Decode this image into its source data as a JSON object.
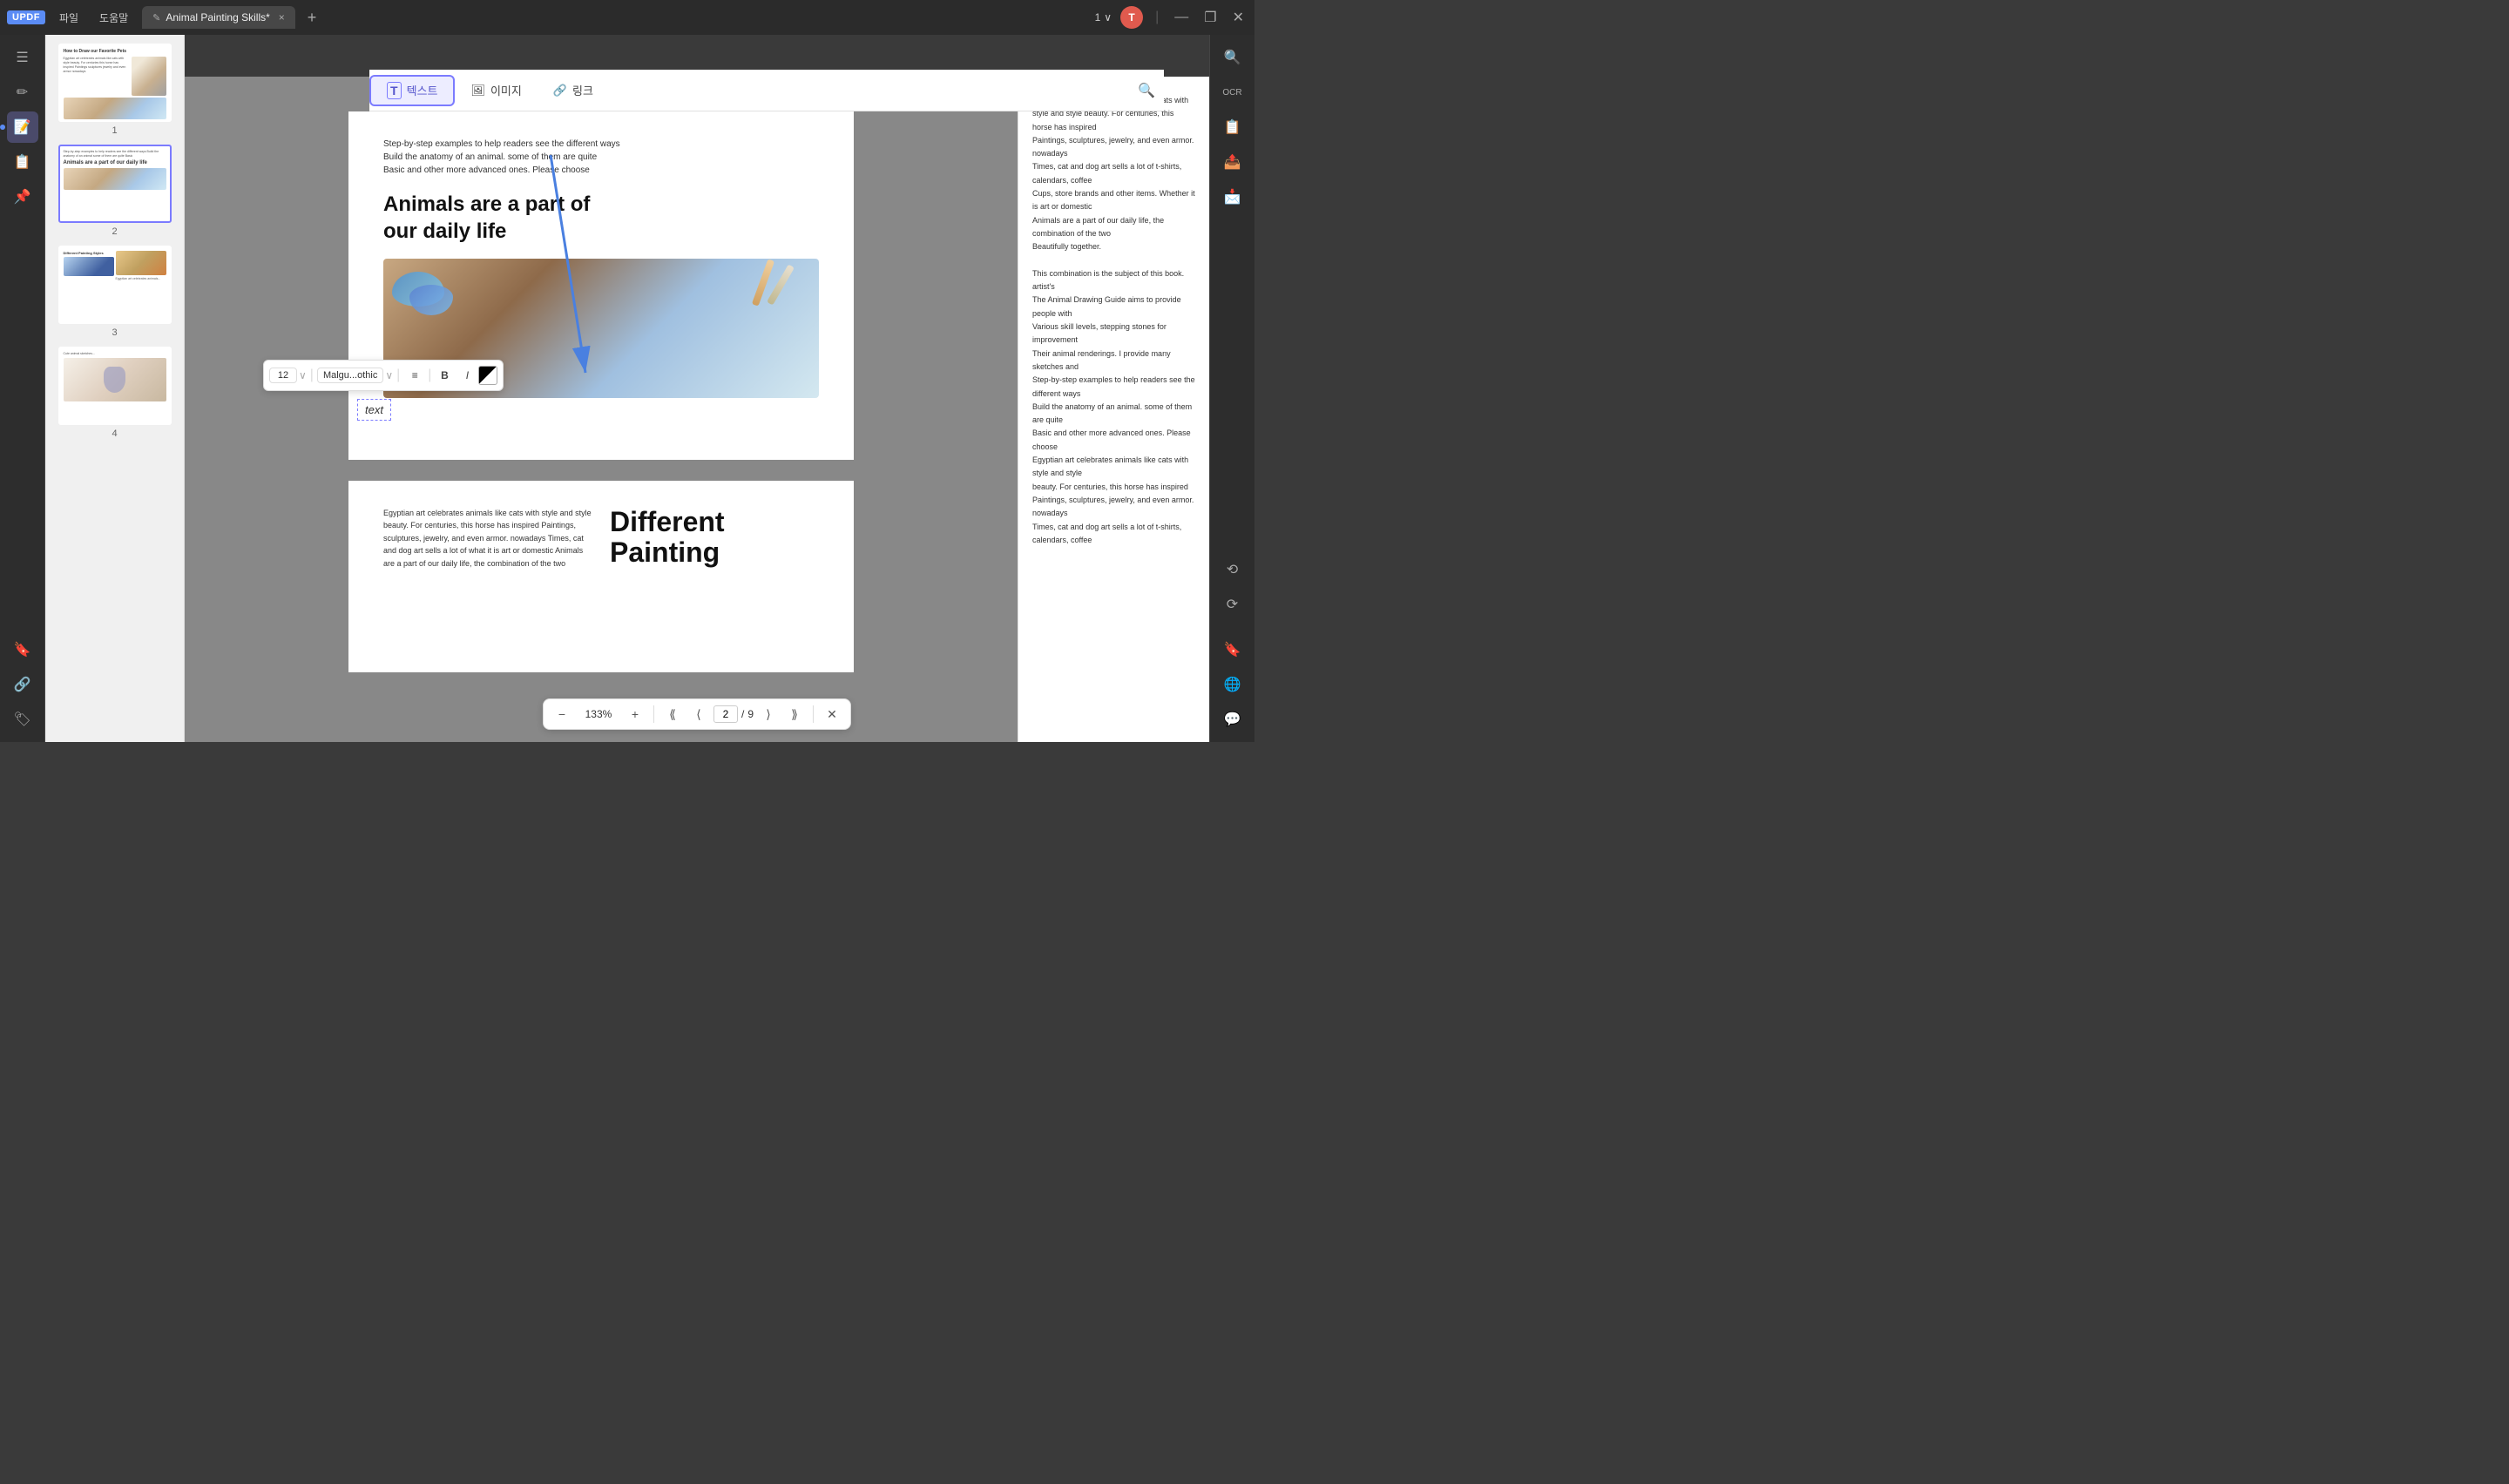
{
  "app": {
    "logo": "UPDF",
    "menu_items": [
      "파일",
      "도움말"
    ],
    "tab_title": "Animal Painting Skills*",
    "tab_close": "×",
    "tab_add": "+",
    "page_nav": "1",
    "page_nav_chevron": "∨",
    "avatar_initial": "T",
    "win_minimize": "—",
    "win_maximize": "❐",
    "win_close": "✕"
  },
  "toolbar": {
    "text_btn": "텍스트",
    "image_btn": "이미지",
    "link_btn": "링크",
    "text_icon": "T",
    "image_icon": "🖼",
    "link_icon": "🔗"
  },
  "sidebar": {
    "icons": [
      "☰",
      "✏",
      "📝",
      "📋",
      "📌",
      "🔖",
      "🔗",
      "🏷",
      "🔍"
    ]
  },
  "thumbnails": [
    {
      "number": "1",
      "selected": false,
      "type": "page1"
    },
    {
      "number": "2",
      "selected": true,
      "type": "page2"
    },
    {
      "number": "3",
      "selected": false,
      "type": "page3"
    },
    {
      "number": "4",
      "selected": false,
      "type": "page4"
    }
  ],
  "page_content": {
    "top_text": "Step-by-step examples to help readers see the different ways\nBuild the anatomy of an animal. some of them are quite\nBasic and other more advanced ones. Please choose",
    "heading_line1": "Animals are a part of",
    "heading_line2": "our daily life",
    "text_box_value": "text"
  },
  "text_toolbar": {
    "font_size": "12",
    "font_name": "Malgu...othic",
    "bold_label": "B",
    "italic_label": "I",
    "align_icon": "≡"
  },
  "right_panel": {
    "text": "Egyptian art celebrates animals like cats with style and style beauty. For centuries, this horse has inspired\nPaintings, sculptures, jewelry, and even armor. nowadays\nTimes, cat and dog art sells a lot of t-shirts, calendars, coffee\nCups, store brands and other items. Whether it is art or domestic\nAnimals are a part of our daily life, the combination of the two\nBeautifully together.\n\nThis combination is the subject of this book. artist's\nThe Animal Drawing Guide aims to provide people with\nVarious skill levels, stepping stones for improvement\nTheir animal renderings. I provide many sketches and\nStep-by-step examples to help readers see the different ways\nBuild the anatomy of an animal. some of them are quite\nBasic and other more advanced ones. Please choose\nEgyptian art celebrates animals like cats with style and style\nbeauty. For centuries, this horse has inspired\nPaintings, sculptures, jewelry, and even armor. nowadays\nTimes, cat and dog art sells a lot of t-shirts, calendars, coffee"
  },
  "second_page": {
    "left_text": "Egyptian art celebrates animals like cats with style and style\nbeauty. For centuries, this horse has inspired\nPaintings, sculptures, jewelry, and even armor. nowadays\nTimes, cat and dog art sells a lot of\nwhat it is art or domestic\nAnimals are a part of our daily life, the combination of the two",
    "heading_line1": "Different Painting"
  },
  "bottom_nav": {
    "zoom_out": "−",
    "zoom_level": "133%",
    "zoom_in": "+",
    "first_page": "⟪",
    "prev_page": "⟨",
    "page_input": "2",
    "page_separator": "/",
    "total_pages": "9",
    "next_page": "⟩",
    "last_page": "⟫",
    "close": "✕"
  },
  "right_sidebar": {
    "icons": [
      "🔍",
      "📊",
      "📋",
      "📤",
      "📩",
      "⟲",
      "⟳",
      "🔖",
      "🌐",
      "💬"
    ]
  },
  "colors": {
    "accent": "#7B7BFF",
    "active_tab_bg": "#474747",
    "toolbar_active_bg": "#ededff",
    "toolbar_active_border": "#7B7BFF"
  }
}
